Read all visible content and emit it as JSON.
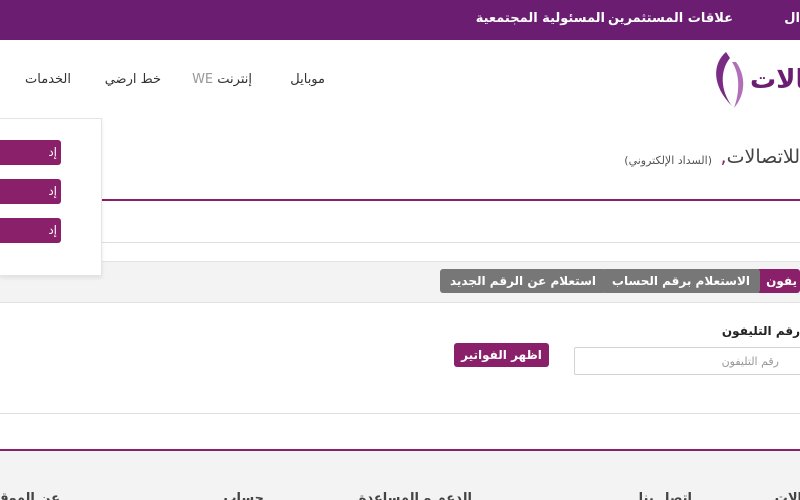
{
  "topbar": {
    "links": [
      {
        "name": "top-link-business",
        "label": "ال"
      },
      {
        "name": "top-link-investor-relations",
        "label": "علاقات المستثمرين"
      },
      {
        "name": "top-link-csr",
        "label": "المسئولية المجتمعية"
      }
    ]
  },
  "header": {
    "logo_text": "صالات",
    "nav": [
      {
        "name": "nav-mobile",
        "label": "موبايل",
        "prefix": ""
      },
      {
        "name": "nav-internet",
        "label": "إنترنت",
        "prefix": "WE"
      },
      {
        "name": "nav-landline",
        "label": "خط ارضي",
        "prefix": ""
      },
      {
        "name": "nav-services",
        "label": "الخدمات",
        "prefix": ""
      }
    ]
  },
  "dropdown": {
    "buttons": [
      "إد",
      "إد",
      "إد"
    ]
  },
  "page": {
    "title": "للاتصالات",
    "title_dot": ",",
    "subtitle": "(السداد الإلكتروني)"
  },
  "tabs": [
    {
      "name": "tab-phone-number",
      "label": "يفون",
      "active": true
    },
    {
      "name": "tab-account-number",
      "label": "الاستعلام برقم الحساب",
      "active": false
    },
    {
      "name": "tab-new-number",
      "label": "استعلام عن الرقم الجديد",
      "active": false
    }
  ],
  "form": {
    "label": "رقم التليفون",
    "phone_placeholder": "رقم التليفون",
    "submit_label": "اظهر الفواتير"
  },
  "footer": {
    "headings": [
      "الات",
      "اتصل بنا",
      "الدعم و المساعدة",
      "حساب",
      "عن الموقع"
    ]
  },
  "colors": {
    "brand_purple": "#6b1d72",
    "accent_magenta": "#8a1f6a",
    "inactive_tab": "#777777"
  }
}
